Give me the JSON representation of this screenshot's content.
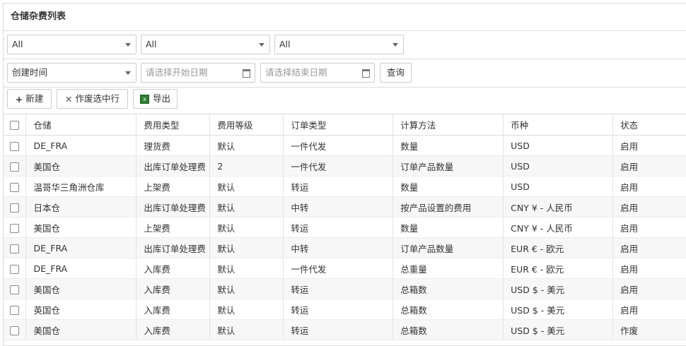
{
  "panel": {
    "title": "仓储杂费列表"
  },
  "filters": {
    "select1": "All",
    "select2": "All",
    "select3": "All",
    "date_field": "创建时间",
    "start_placeholder": "请选择开始日期",
    "end_placeholder": "请选择结束日期",
    "search_label": "查询"
  },
  "toolbar": {
    "new_label": "新建",
    "void_label": "作废选中行",
    "export_label": "导出"
  },
  "table": {
    "headers": [
      "仓储",
      "费用类型",
      "费用等级",
      "订单类型",
      "计算方法",
      "币种",
      "状态"
    ],
    "rows": [
      [
        "DE_FRA",
        "理货费",
        "默认",
        "一件代发",
        "数量",
        "USD",
        "启用"
      ],
      [
        "美国仓",
        "出库订单处理费",
        "2",
        "一件代发",
        "订单产品数量",
        "USD",
        "启用"
      ],
      [
        "温哥华三角洲仓库",
        "上架费",
        "默认",
        "转运",
        "数量",
        "USD",
        "启用"
      ],
      [
        "日本仓",
        "出库订单处理费",
        "默认",
        "中转",
        "按产品设置的费用",
        "CNY ¥ - 人民币",
        "启用"
      ],
      [
        "美国仓",
        "上架费",
        "默认",
        "转运",
        "数量",
        "CNY ¥ - 人民币",
        "启用"
      ],
      [
        "DE_FRA",
        "出库订单处理费",
        "默认",
        "中转",
        "订单产品数量",
        "EUR € - 欧元",
        "启用"
      ],
      [
        "DE_FRA",
        "入库费",
        "默认",
        "一件代发",
        "总重量",
        "EUR € - 欧元",
        "启用"
      ],
      [
        "美国仓",
        "入库费",
        "默认",
        "转运",
        "总箱数",
        "USD $ - 美元",
        "启用"
      ],
      [
        "英国仓",
        "入库费",
        "默认",
        "转运",
        "总箱数",
        "USD $ - 美元",
        "启用"
      ],
      [
        "美国仓",
        "入库费",
        "默认",
        "转运",
        "总箱数",
        "USD $ - 美元",
        "作废"
      ]
    ]
  }
}
